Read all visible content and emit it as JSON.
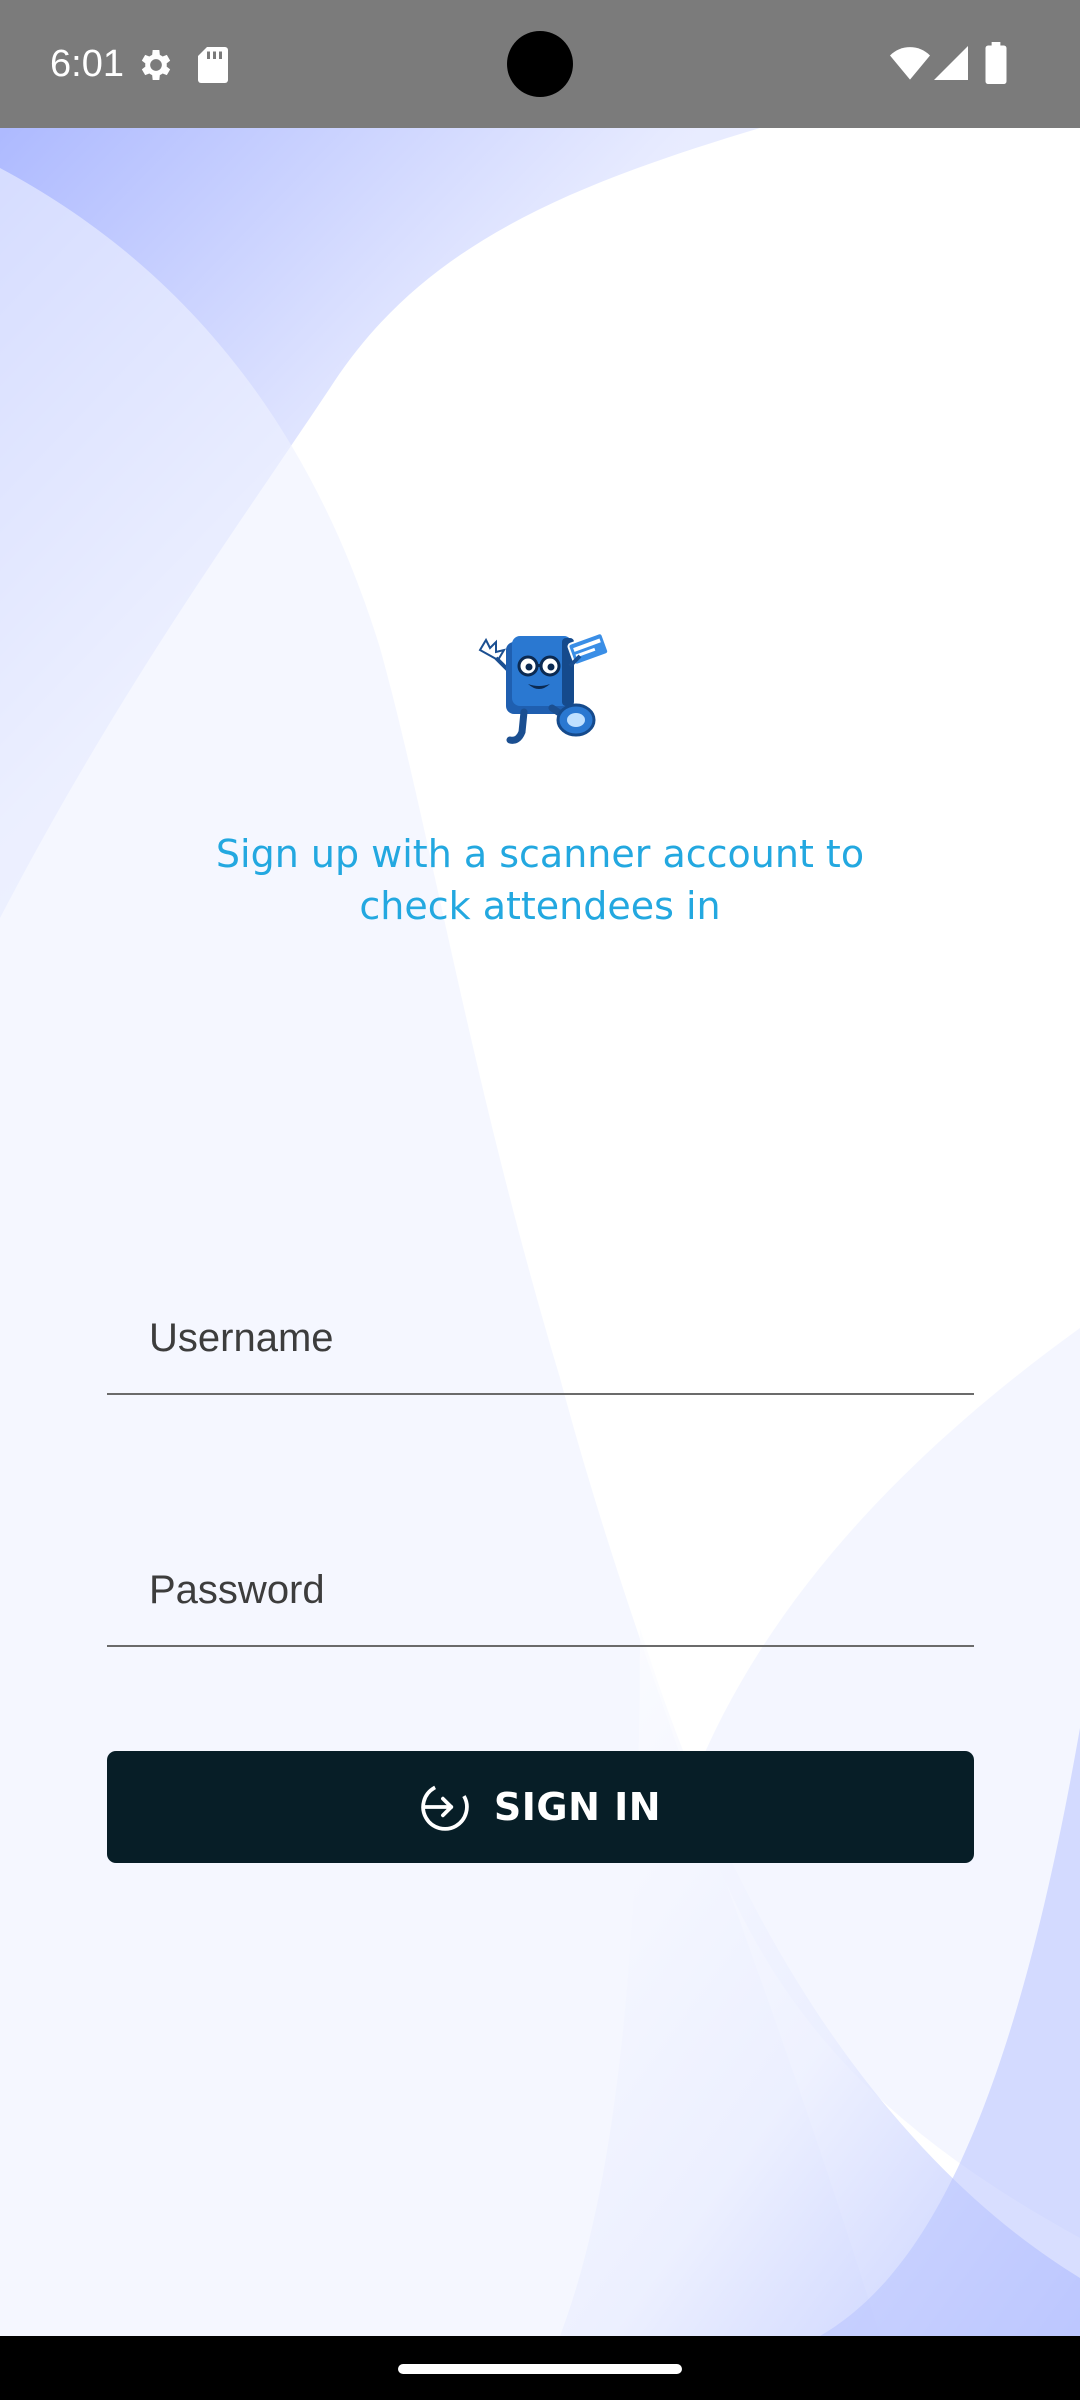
{
  "status_bar": {
    "time": "6:01",
    "icons": [
      "settings-gear-icon",
      "sd-card-icon",
      "wifi-icon",
      "cellular-signal-icon",
      "battery-icon"
    ]
  },
  "login": {
    "tagline_line1": "Sign up with a scanner account to",
    "tagline_line2": "check attendees in",
    "username_placeholder": "Username",
    "username_value": "",
    "password_placeholder": "Password",
    "password_value": "",
    "signin_label": "SIGN IN",
    "signin_icon": "login-arrow-icon"
  },
  "colors": {
    "status_bar": "#7b7b7b",
    "tagline": "#23a8e0",
    "button": "#071e27",
    "background_accent": "#aab8ff"
  }
}
